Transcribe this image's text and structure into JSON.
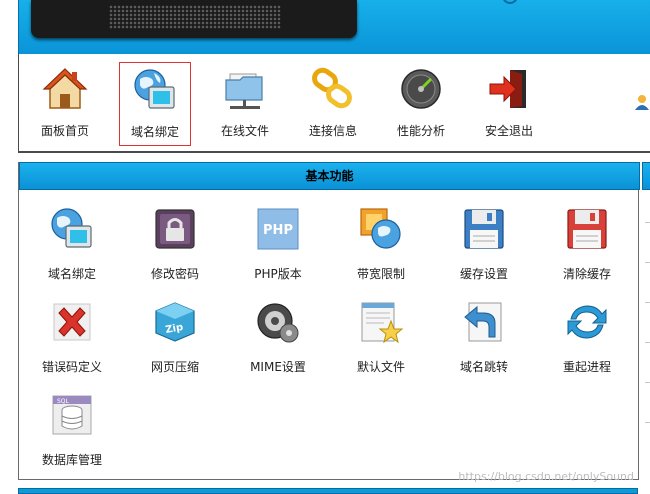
{
  "toolbar": {
    "items": [
      {
        "label": "面板首页",
        "icon": "home-icon"
      },
      {
        "label": "域名绑定",
        "icon": "globe-window-icon"
      },
      {
        "label": "在线文件",
        "icon": "network-folder-icon"
      },
      {
        "label": "连接信息",
        "icon": "chain-link-icon"
      },
      {
        "label": "性能分析",
        "icon": "gauge-icon"
      },
      {
        "label": "安全退出",
        "icon": "exit-door-icon"
      }
    ],
    "selected_label": "域名绑定"
  },
  "panel": {
    "title": "基本功能",
    "items": [
      {
        "label": "域名绑定",
        "icon": "globe-window-icon"
      },
      {
        "label": "修改密码",
        "icon": "lock-icon"
      },
      {
        "label": "PHP版本",
        "icon": "php-icon",
        "icon_text": "PHP"
      },
      {
        "label": "带宽限制",
        "icon": "bandwidth-globe-icon"
      },
      {
        "label": "缓存设置",
        "icon": "floppy-blue-icon"
      },
      {
        "label": "清除缓存",
        "icon": "floppy-red-icon"
      },
      {
        "label": "错误码定义",
        "icon": "red-x-icon"
      },
      {
        "label": "网页压缩",
        "icon": "zip-box-icon",
        "icon_text": "Zip"
      },
      {
        "label": "MIME设置",
        "icon": "gear-icon"
      },
      {
        "label": "默认文件",
        "icon": "document-star-icon"
      },
      {
        "label": "域名跳转",
        "icon": "redirect-arrow-icon"
      },
      {
        "label": "重起进程",
        "icon": "refresh-icon"
      },
      {
        "label": "数据库管理",
        "icon": "database-icon",
        "icon_text": "SQL"
      }
    ]
  },
  "watermark": "https://blog.csdn.net/onlySound",
  "colors": {
    "header_blue": "#0a94d8",
    "selected_border": "#dd3333",
    "logo_panel": "#1b1b1b"
  }
}
